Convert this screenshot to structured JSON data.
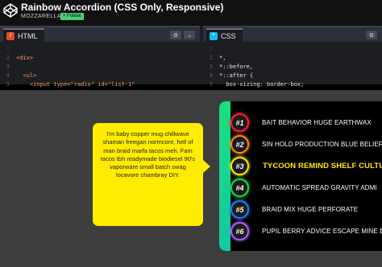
{
  "header": {
    "title": "Rainbow Accordion (CSS Only, Responsive)",
    "author": "MOZZARELLA",
    "follow_label": "+ Follow"
  },
  "html_pane": {
    "label": "HTML",
    "settings_icon": "gear-icon",
    "collapse_icon": "chevron-down-icon",
    "lines": [
      {
        "n": "1",
        "t": ""
      },
      {
        "n": "2",
        "t": "<div>"
      },
      {
        "n": "3",
        "t": ""
      },
      {
        "n": "4",
        "t": "  <ul>"
      },
      {
        "n": "5",
        "t": "    <input type=\"radio\" id=\"list-1\""
      }
    ]
  },
  "css_pane": {
    "label": "CSS",
    "settings_icon": "gear-icon",
    "lines": [
      {
        "n": "1",
        "t": ""
      },
      {
        "n": "2",
        "t": "*,"
      },
      {
        "n": "3",
        "t": "*::before,"
      },
      {
        "n": "4",
        "t": "*::after {"
      },
      {
        "n": "5",
        "t": "  box-sizing: border-box;"
      }
    ]
  },
  "preview": {
    "bubble_text": "I'm baby copper mug chillwave shaman freegan normcore, hell of man braid marfa tacos meh. Fam tacos tbh readymade biodiesel 90's vaporware small batch swag locavore chambray DIY.",
    "items": [
      {
        "num": "#1",
        "label": "BAIT BEHAVIOR HUGE EARTHWAX",
        "color": "#ff1f3d",
        "active": false
      },
      {
        "num": "#2",
        "label": "SIN HOLD PRODUCTION BLUE BELIEF",
        "color": "#ff8a00",
        "active": false
      },
      {
        "num": "#3",
        "label": "TYCOON REMIND SHELF CULTU",
        "color": "#ffec00",
        "active": true
      },
      {
        "num": "#4",
        "label": "AUTOMATIC SPREAD GRAVITY ADMI",
        "color": "#19d943",
        "active": false
      },
      {
        "num": "#5",
        "label": "BRAID MIX HUGE PERFORATE",
        "color": "#1e7bff",
        "active": false
      },
      {
        "num": "#6",
        "label": "PUPIL BERRY ADVICE ESCAPE MINE EN",
        "color": "#b05cff",
        "active": false
      }
    ]
  }
}
